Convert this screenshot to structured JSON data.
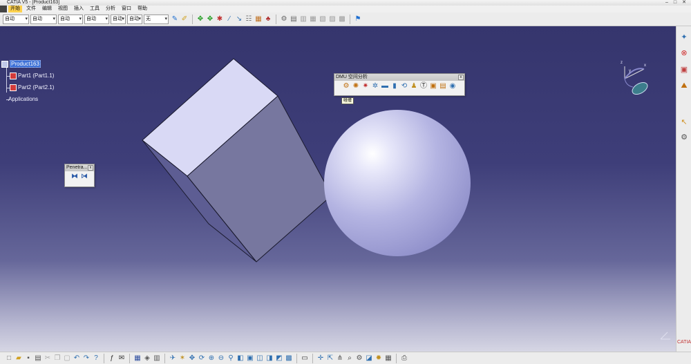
{
  "window": {
    "title": "CATIA V5 - [Product163]"
  },
  "menu": [
    "开始",
    "文件",
    "编辑",
    "视图",
    "插入",
    "工具",
    "分析",
    "窗口",
    "帮助"
  ],
  "toolbar_top": {
    "combos": [
      "自动",
      "自动",
      "自动",
      "自动",
      "自动",
      "自动",
      "无"
    ],
    "icons": [
      "paint-icon",
      "brush-icon",
      "move-icon",
      "compass-move-icon",
      "explode-icon",
      "wand-icon",
      "snap-icon",
      "arrange-icon",
      "scene-icon",
      "chart-icon",
      "doc-icon",
      "table-icon",
      "table2-icon",
      "grid-icon",
      "insert-icon"
    ]
  },
  "tree": {
    "root": "Product163",
    "children": [
      "Part1 (Part1.1)",
      "Part2 (Part2.1)"
    ],
    "applications": "Applications"
  },
  "panels": {
    "penetration": {
      "title": "Penetra...",
      "close": "x"
    },
    "dmu": {
      "title": "DMU 空间分析",
      "close": "x",
      "tooltip": "碰撞"
    }
  },
  "compass": {
    "z": "z",
    "x": "x",
    "y": "y"
  },
  "colors": {
    "viewport_top": "#35356d",
    "cube_top": "#d9d9f5",
    "cube_side": "#7676ac",
    "sphere": "#b8b8e6",
    "tree_selection": "#3b6fd6"
  },
  "toolbar_right": [
    "catia-icon",
    "stop-icon",
    "save-icon",
    "measure-icon",
    "select-icon",
    "tools-icon"
  ],
  "toolbar_bottom": [
    "new-icon",
    "open-icon",
    "save-icon",
    "print-icon",
    "cut-icon",
    "copy-icon",
    "paste-icon",
    "undo-icon",
    "redo-icon",
    "whats-this-icon",
    "formula-icon",
    "comment-icon",
    "catalog-icon",
    "properties-icon",
    "view-icon",
    "fly-icon",
    "pan-icon",
    "rotate-icon",
    "zoom-in-icon",
    "zoom-out-icon",
    "normal-view-icon",
    "iso-view-icon",
    "fit-all-icon",
    "hide-icon",
    "show-icon",
    "render-icon",
    "swap-icon",
    "camera-icon",
    "compass-icon",
    "keyboard-icon",
    "search-icon",
    "material-icon",
    "shading-icon",
    "light-icon",
    "grid-icon",
    "tree-icon",
    "axis-icon"
  ],
  "brand": "CATIA"
}
